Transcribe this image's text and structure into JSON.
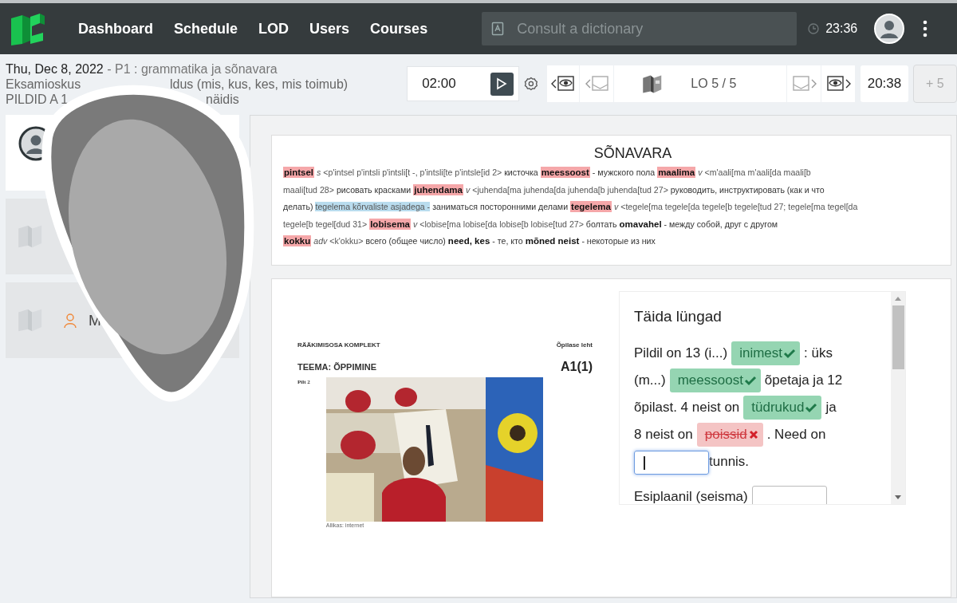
{
  "nav": {
    "items": [
      {
        "label": "Dashboard"
      },
      {
        "label": "Schedule"
      },
      {
        "label": "LOD"
      },
      {
        "label": "Users"
      },
      {
        "label": "Courses"
      }
    ]
  },
  "search": {
    "placeholder": "Consult a dictionary"
  },
  "clock": "23:36",
  "lesson": {
    "date": "Thu, Dec 8, 2022",
    "topic": " - P1 : grammatika ja sõnavara",
    "line_2_start": "Eksamioskus",
    "line_2_end": "ldus (mis, kus, kes, mis toimub)",
    "line_3_start": "PILDID A 1",
    "line_3_end": "näidis"
  },
  "toolbar": {
    "timer": "02:00",
    "lo": "LO 5 / 5",
    "elapsed": "20:38",
    "extend": {
      "label": "+ 5",
      "disabled": true
    }
  },
  "sidebar": {
    "cards": [
      {
        "kind": "avatar",
        "selected": true
      },
      {
        "kind": "book",
        "selected": false
      },
      {
        "kind": "book-user",
        "selected": false,
        "label": "M"
      }
    ]
  },
  "vocabulary": {
    "title": "SÕNAVARA",
    "lines": [
      [
        {
          "kind": "head",
          "text": "pintsel"
        },
        {
          "kind": "pos",
          "text": "s"
        },
        {
          "kind": "forms",
          "text": "<p'intsel p'intsli p'intsli[t -, p'intsli[te p'intsle[id 2>"
        },
        {
          "kind": "ru",
          "text": "кисточка"
        },
        {
          "kind": "head",
          "text": "meessoost"
        },
        {
          "kind": "ru",
          "text": "- мужского пола"
        },
        {
          "kind": "head",
          "text": "maalima"
        },
        {
          "kind": "pos",
          "text": "v"
        },
        {
          "kind": "forms",
          "text": "<m'aali[ma m'aali[da maali[b"
        }
      ],
      [
        {
          "kind": "forms",
          "text": "maali[tud 28>"
        },
        {
          "kind": "ru",
          "text": "рисовать красками"
        },
        {
          "kind": "head",
          "text": "juhendama"
        },
        {
          "kind": "pos",
          "text": "v"
        },
        {
          "kind": "forms",
          "text": "<juhenda[ma juhenda[da juhenda[b juhenda[tud 27>"
        },
        {
          "kind": "ru",
          "text": "руководить, инструктировать (как и что"
        }
      ],
      [
        {
          "kind": "ru",
          "text": "делать)"
        },
        {
          "kind": "phrase",
          "text": "tegelema kõrvaliste asjadega -"
        },
        {
          "kind": "ru",
          "text": "заниматься посторонними делами"
        },
        {
          "kind": "head",
          "text": "tegelema"
        },
        {
          "kind": "pos",
          "text": "v"
        },
        {
          "kind": "forms",
          "text": "<tegele[ma tegele[da tegele[b tegele[tud 27; tegele[ma tegel[da"
        }
      ],
      [
        {
          "kind": "forms",
          "text": "tegele[b tegel[dud 31>"
        },
        {
          "kind": "head",
          "text": "lobisema"
        },
        {
          "kind": "pos",
          "text": "v"
        },
        {
          "kind": "forms",
          "text": "<lobise[ma lobise[da lobise[b lobise[tud 27>"
        },
        {
          "kind": "ru",
          "text": "болтать"
        },
        {
          "kind": "bold",
          "text": "omavahel"
        },
        {
          "kind": "ru",
          "text": "- между собой, друг с другом"
        }
      ],
      [
        {
          "kind": "head",
          "text": "kokku"
        },
        {
          "kind": "pos",
          "text": "adv"
        },
        {
          "kind": "forms",
          "text": "<k'okku>"
        },
        {
          "kind": "ru",
          "text": "всего (общее число)"
        },
        {
          "kind": "bold",
          "text": "need, kes"
        },
        {
          "kind": "ru",
          "text": "- те, кто"
        },
        {
          "kind": "bold",
          "text": "mõned neist"
        },
        {
          "kind": "ru",
          "text": "- некоторые из них"
        }
      ]
    ]
  },
  "document": {
    "series": "RÄÄKIMISOSA KOMPLEKT",
    "sheet": "Õpilase leht",
    "theme": "TEEMA: ÕPPIMINE",
    "level": "A1(1)",
    "figure_label": "Pilt 2",
    "caption": "Allikas: internet"
  },
  "exercise": {
    "title": "Täida lüngad",
    "lines": [
      [
        {
          "kind": "text",
          "text": "Pildil on 13 (i...)"
        },
        {
          "kind": "answer",
          "text": "inimest",
          "correct": true
        },
        {
          "kind": "text",
          "text": ": üks"
        }
      ],
      [
        {
          "kind": "text",
          "text": "(m...)"
        },
        {
          "kind": "answer",
          "text": "meessoost",
          "correct": true
        },
        {
          "kind": "text",
          "text": "õpetaja ja 12"
        }
      ],
      [
        {
          "kind": "text",
          "text": "õpilast. 4 neist on"
        },
        {
          "kind": "answer",
          "text": "tüdrukud",
          "correct": true
        },
        {
          "kind": "text",
          "text": "ja"
        }
      ],
      [
        {
          "kind": "text",
          "text": "8 neist on"
        },
        {
          "kind": "answer",
          "text": "poissid",
          "correct": false
        },
        {
          "kind": "text",
          "text": ". Need on"
        }
      ],
      [
        {
          "kind": "input",
          "focused": true
        },
        {
          "kind": "text",
          "text": "tunnis."
        }
      ],
      [
        {
          "kind": "text",
          "text": "Esiplaanil (seisma)"
        },
        {
          "kind": "input",
          "focused": false
        }
      ]
    ]
  }
}
